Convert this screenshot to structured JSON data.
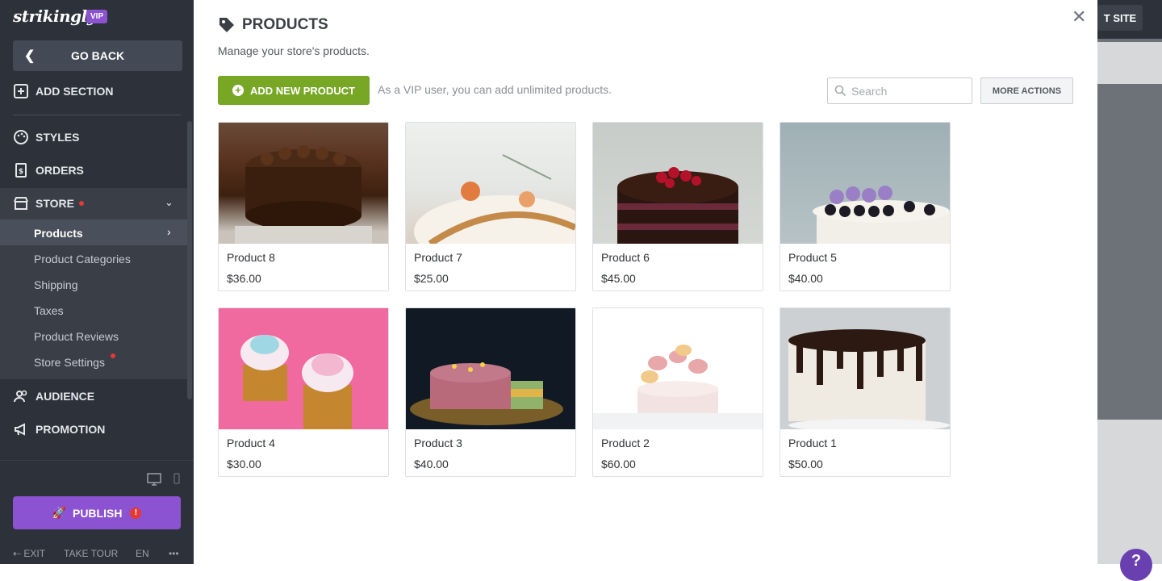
{
  "sidebar": {
    "logo": "strikingly",
    "vip_badge": "VIP",
    "go_back": "GO BACK",
    "nav": {
      "add_section": "ADD SECTION",
      "styles": "STYLES",
      "orders": "ORDERS",
      "store": "STORE",
      "audience": "AUDIENCE",
      "promotion": "PROMOTION"
    },
    "store_items": [
      "Products",
      "Product Categories",
      "Shipping",
      "Taxes",
      "Product Reviews",
      "Store Settings"
    ],
    "publish": "PUBLISH",
    "publish_alert": "!",
    "footer": {
      "exit": "EXIT",
      "take_tour": "TAKE TOUR",
      "lang": "EN",
      "more": "•••"
    }
  },
  "topbar": {
    "visit_site": "T SITE"
  },
  "help": "?",
  "modal": {
    "title": "PRODUCTS",
    "subtitle": "Manage your store's products.",
    "add_button": "ADD NEW PRODUCT",
    "hint": "As a VIP user, you can add unlimited products.",
    "search_placeholder": "Search",
    "more_actions": "MORE ACTIONS",
    "close": "✕",
    "products": [
      {
        "name": "Product 8",
        "price": "$36.00"
      },
      {
        "name": "Product 7",
        "price": "$25.00"
      },
      {
        "name": "Product 6",
        "price": "$45.00"
      },
      {
        "name": "Product 5",
        "price": "$40.00"
      },
      {
        "name": "Product 4",
        "price": "$30.00"
      },
      {
        "name": "Product 3",
        "price": "$40.00"
      },
      {
        "name": "Product 2",
        "price": "$60.00"
      },
      {
        "name": "Product 1",
        "price": "$50.00"
      }
    ]
  },
  "colors": {
    "sidebar_bg": "#2d3139",
    "accent_green": "#77a725",
    "accent_purple": "#8b52d1",
    "alert_red": "#e53935"
  }
}
